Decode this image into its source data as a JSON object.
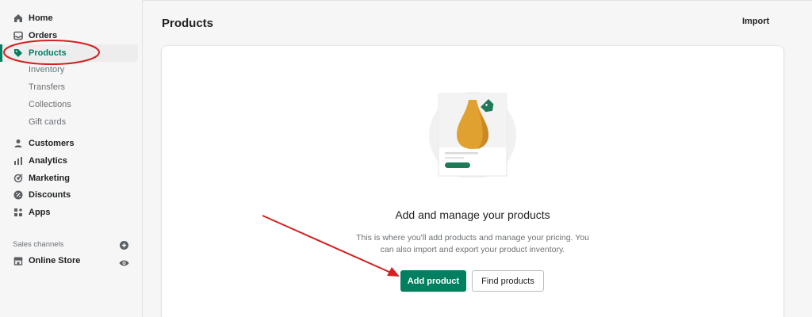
{
  "sidebar": {
    "items": [
      {
        "label": "Home",
        "icon": "home-icon"
      },
      {
        "label": "Orders",
        "icon": "inbox-icon"
      },
      {
        "label": "Products",
        "icon": "tag-icon"
      },
      {
        "label": "Customers",
        "icon": "person-icon"
      },
      {
        "label": "Analytics",
        "icon": "bar-chart-icon"
      },
      {
        "label": "Marketing",
        "icon": "target-icon"
      },
      {
        "label": "Discounts",
        "icon": "discount-icon"
      },
      {
        "label": "Apps",
        "icon": "apps-icon"
      }
    ],
    "product_subitems": [
      "Inventory",
      "Transfers",
      "Collections",
      "Gift cards"
    ],
    "sales_channels_label": "Sales channels",
    "online_store_label": "Online Store"
  },
  "header": {
    "title": "Products",
    "import_label": "Import"
  },
  "empty_state": {
    "heading": "Add and manage your products",
    "body": "This is where you'll add products and manage your pricing. You can also import and export your product inventory.",
    "primary_label": "Add product",
    "secondary_label": "Find products"
  },
  "colors": {
    "accent": "#008060",
    "annotation": "#d42020"
  }
}
